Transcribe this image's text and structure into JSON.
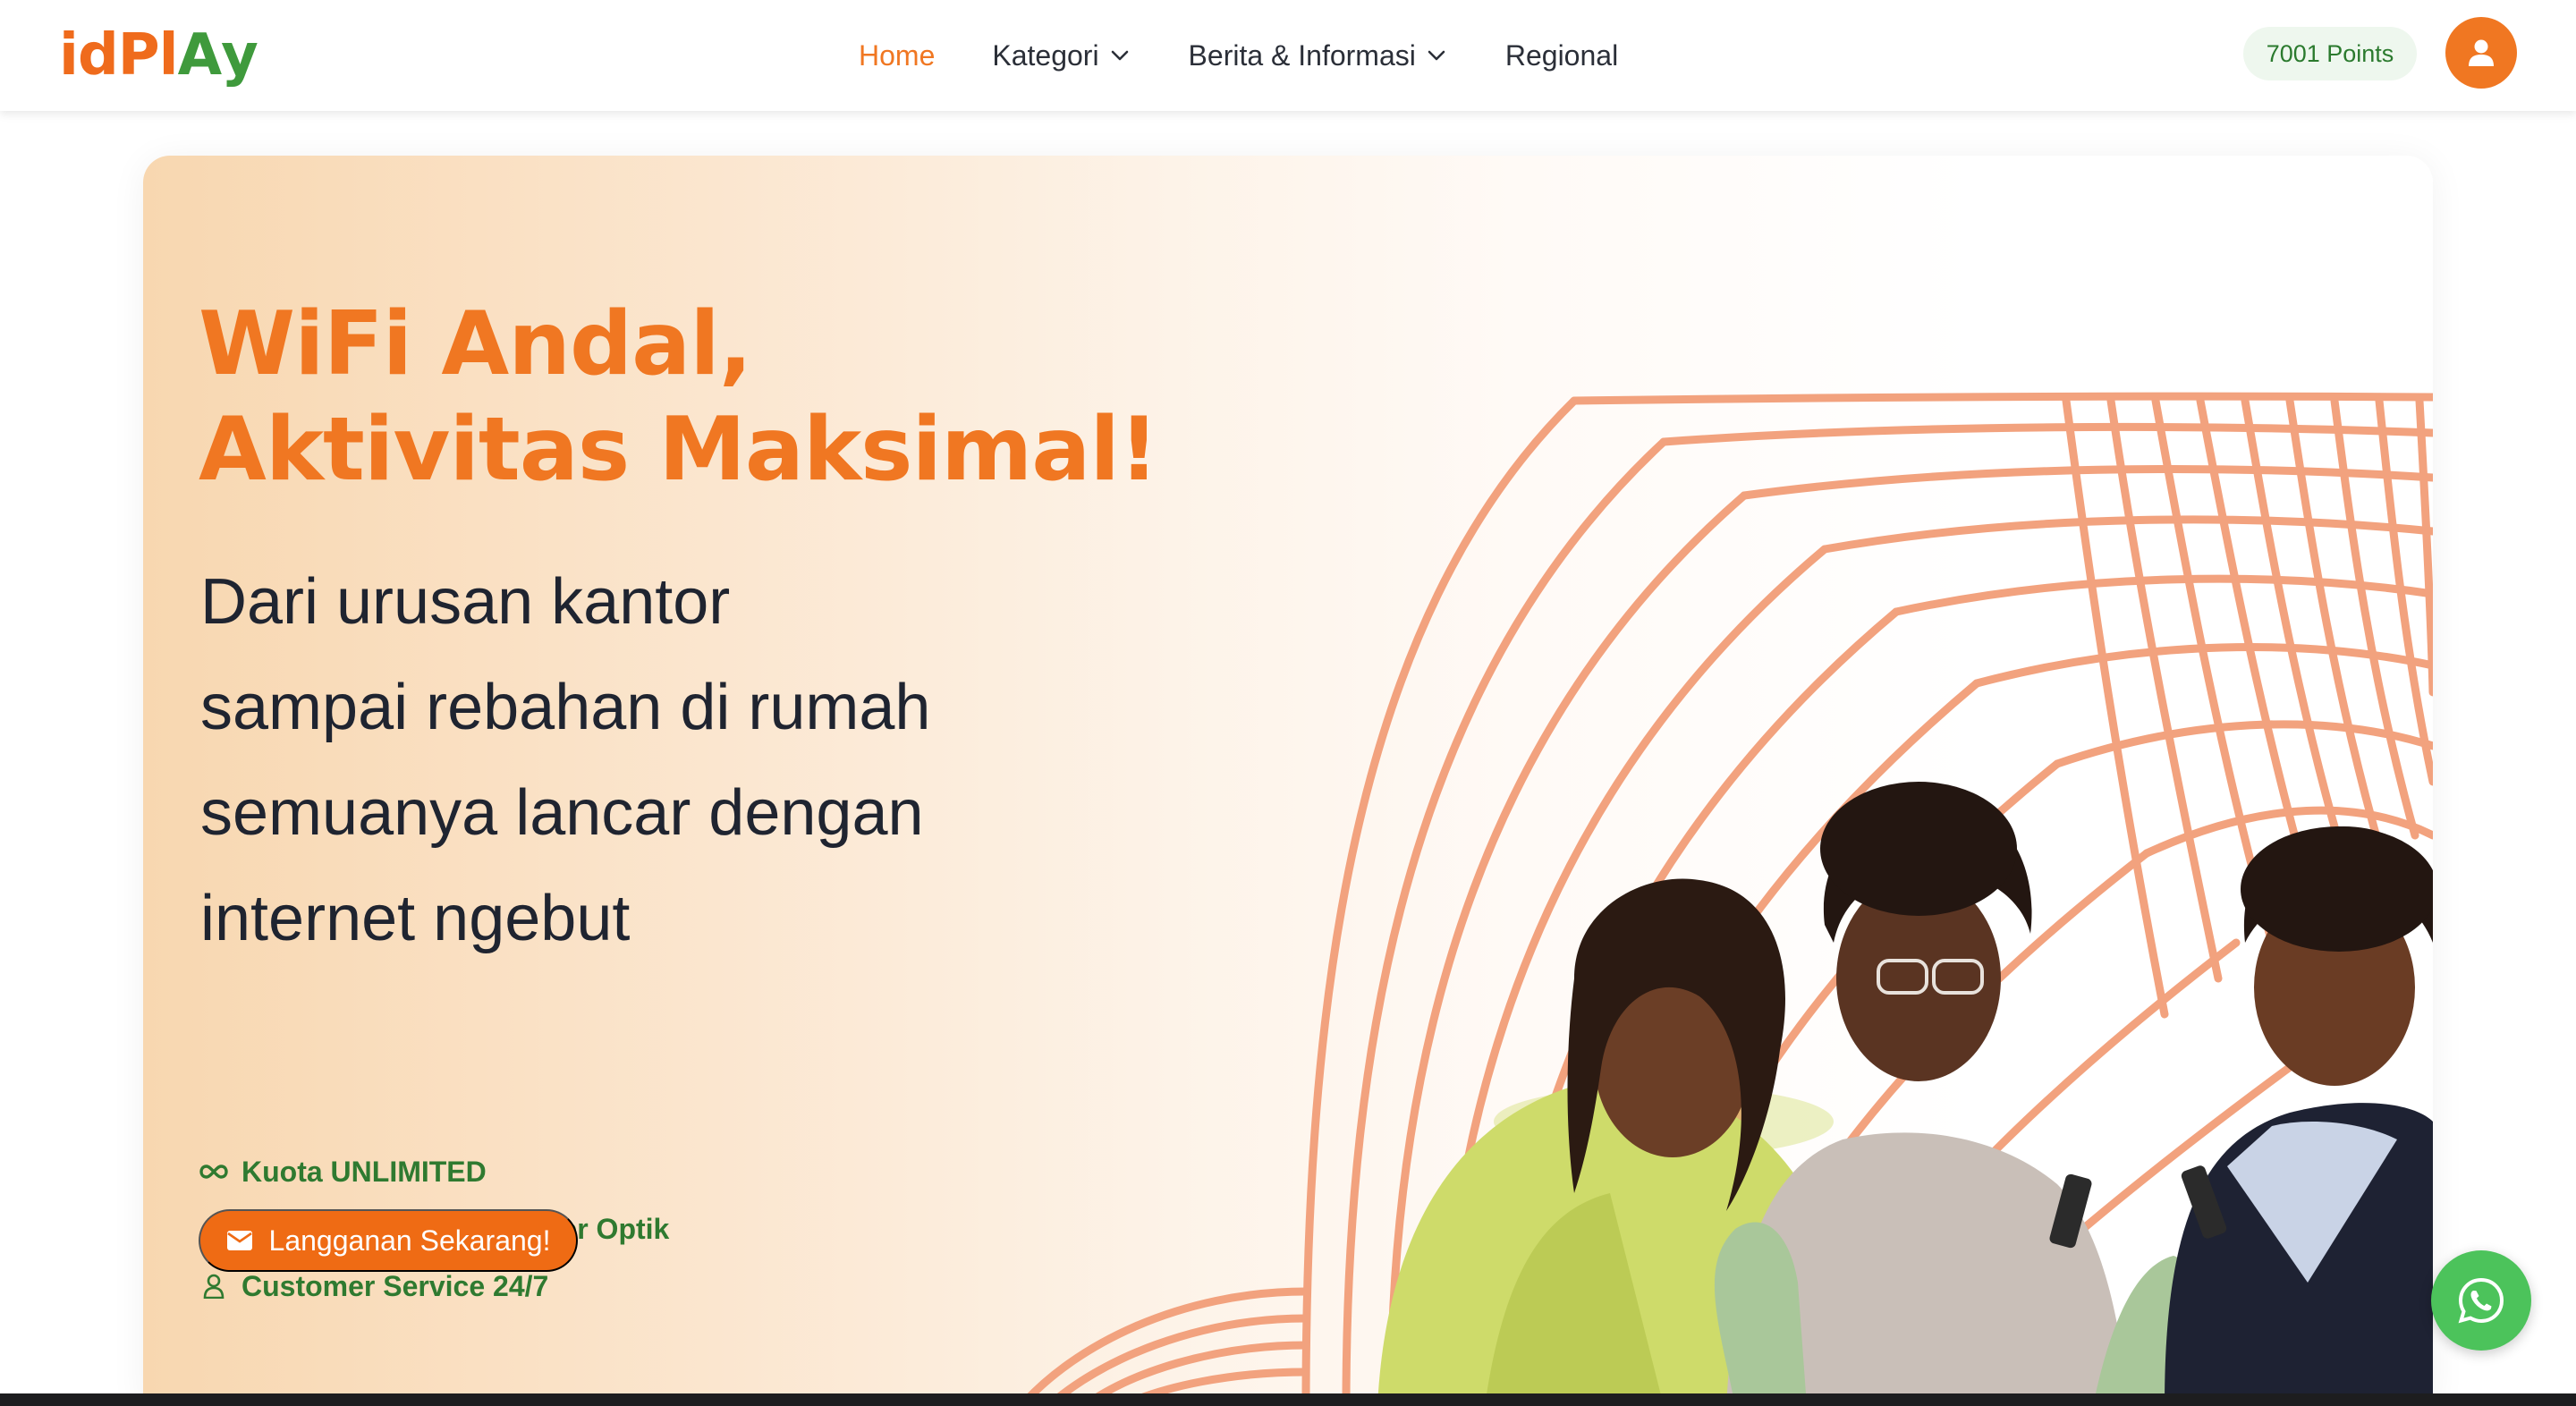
{
  "brand": {
    "logo_text": "idPlAy",
    "accent_orange": "#f07722",
    "accent_green": "#3f9a3c"
  },
  "nav": {
    "items": [
      {
        "label": "Home",
        "active": true
      },
      {
        "label": "Kategori",
        "dropdown": true
      },
      {
        "label": "Berita & Informasi",
        "dropdown": true
      },
      {
        "label": "Regional"
      }
    ]
  },
  "user": {
    "points": "7001 Points",
    "avatar_icon": "user-icon"
  },
  "hero": {
    "title_line1": "WiFi Andal,",
    "title_line2": "Aktivitas Maksimal!",
    "subtitle_lines": [
      "Dari urusan kantor",
      "sampai rebahan di rumah",
      "semuanya lancar dengan",
      "internet ngebut"
    ],
    "features": [
      {
        "icon": "infinity-icon",
        "label": "Kuota UNLIMITED"
      },
      {
        "icon": "signal-bars-icon",
        "label": "Stabil dengan 100% Fiber Optik"
      },
      {
        "icon": "person-icon",
        "label": "Customer Service 24/7"
      }
    ],
    "cta_label": "Langganan Sekarang!",
    "cta_icon": "mail-icon"
  },
  "floating": {
    "whatsapp_icon": "whatsapp-icon"
  }
}
